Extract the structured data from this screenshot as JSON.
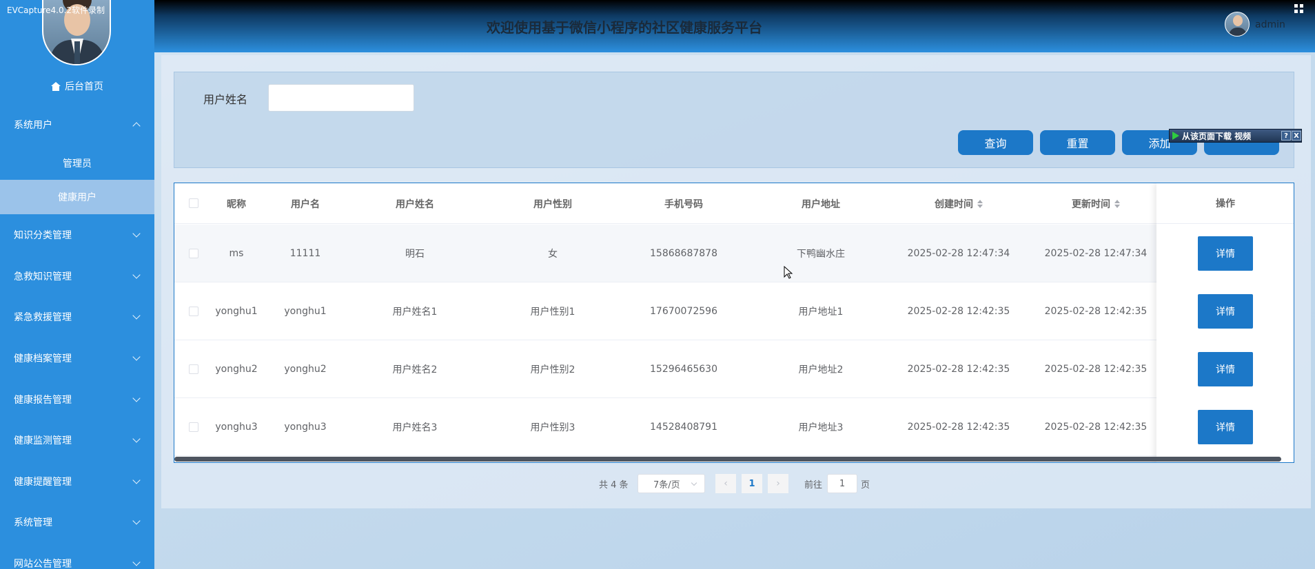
{
  "recorder_label": "EVCapture4.0.2软件录制",
  "header": {
    "title": "欢迎使用基于微信小程序的社区健康服务平台",
    "user": "admin"
  },
  "sidebar": {
    "home": "后台首页",
    "items": [
      {
        "label": "系统用户",
        "expanded": true
      },
      {
        "label": "知识分类管理"
      },
      {
        "label": "急救知识管理"
      },
      {
        "label": "紧急救援管理"
      },
      {
        "label": "健康档案管理"
      },
      {
        "label": "健康报告管理"
      },
      {
        "label": "健康监测管理"
      },
      {
        "label": "健康提醒管理"
      },
      {
        "label": "系统管理"
      },
      {
        "label": "网站公告管理"
      }
    ],
    "submenu": [
      {
        "label": "管理员"
      },
      {
        "label": "健康用户",
        "active": true
      }
    ]
  },
  "search": {
    "label": "用户姓名",
    "value": "",
    "buttons": {
      "query": "查询",
      "reset": "重置",
      "add": "添加"
    }
  },
  "overlay": {
    "label": "从该页面下载 视频",
    "help": "?",
    "close": "X"
  },
  "table": {
    "columns": [
      "昵称",
      "用户名",
      "用户姓名",
      "用户性别",
      "手机号码",
      "用户地址",
      "创建时间",
      "更新时间",
      "操作"
    ],
    "rows": [
      {
        "nickname": "ms",
        "username": "11111",
        "name": "明石",
        "gender": "女",
        "phone": "15868687878",
        "address": "下鸭幽水庄",
        "created": "2025-02-28 12:47:34",
        "updated": "2025-02-28 12:47:34",
        "action": "详情"
      },
      {
        "nickname": "yonghu1",
        "username": "yonghu1",
        "name": "用户姓名1",
        "gender": "用户性别1",
        "phone": "17670072596",
        "address": "用户地址1",
        "created": "2025-02-28 12:42:35",
        "updated": "2025-02-28 12:42:35",
        "action": "详情"
      },
      {
        "nickname": "yonghu2",
        "username": "yonghu2",
        "name": "用户姓名2",
        "gender": "用户性别2",
        "phone": "15296465630",
        "address": "用户地址2",
        "created": "2025-02-28 12:42:35",
        "updated": "2025-02-28 12:42:35",
        "action": "详情"
      },
      {
        "nickname": "yonghu3",
        "username": "yonghu3",
        "name": "用户姓名3",
        "gender": "用户性别3",
        "phone": "14528408791",
        "address": "用户地址3",
        "created": "2025-02-28 12:42:35",
        "updated": "2025-02-28 12:42:35",
        "action": "详情"
      }
    ]
  },
  "pagination": {
    "total": "共 4 条",
    "page_size": "7条/页",
    "prev": "‹",
    "current": "1",
    "next": "›",
    "goto_label": "前往",
    "goto_value": "1",
    "goto_suffix": "页"
  }
}
